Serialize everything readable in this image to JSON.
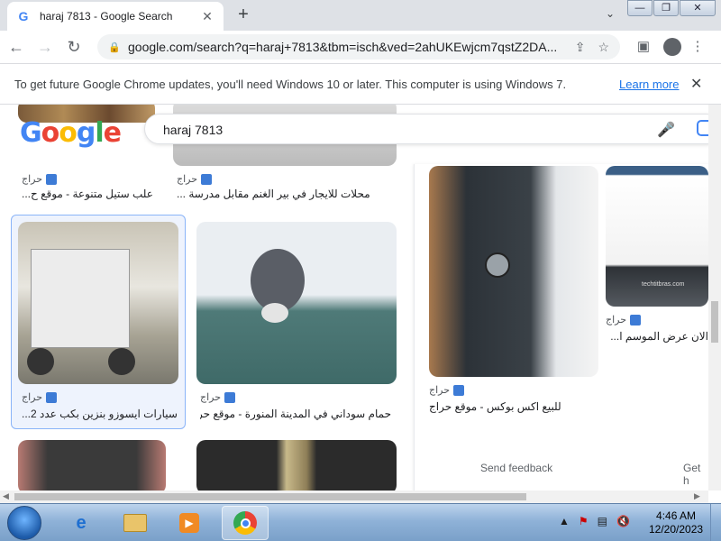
{
  "browser": {
    "tab": {
      "title": "haraj 7813 - Google Search",
      "favicon": "G"
    },
    "new_tab_label": "+",
    "url": "google.com/search?q=haraj+7813&tbm=isch&ved=2ahUKEwjcm7qstZ2DA...",
    "window_buttons": {
      "minimize": "—",
      "restore": "❐",
      "close": "✕"
    }
  },
  "infobar": {
    "message": "To get future Google Chrome updates, you'll need Windows 10 or later. This computer is using Windows 7.",
    "learn_more": "Learn more",
    "close": "✕"
  },
  "search": {
    "query": "haraj 7813",
    "logo": "Google"
  },
  "results": [
    {
      "source": "حراج",
      "caption": "علب ستيل متنوعة - موقع ح..."
    },
    {
      "source": "حراج",
      "caption": "محلات للايجار في بير الغنم مقابل مدرسة ..."
    },
    {
      "source": "حراج",
      "caption": "سيارات ايسوزو بنزين بكب عدد 2..."
    },
    {
      "source": "حراج",
      "caption": "حمام سوداني في المدينة المنورة - موقع حراج"
    }
  ],
  "panel": {
    "main": {
      "source": "حراج",
      "caption": "للبيع اكس بوكس - موقع حراج"
    },
    "side": {
      "source": "حراج",
      "caption": "الان عرض الموسم ا..."
    },
    "side_thumb_text": "techtitbras.com",
    "feedback": "Send feedback",
    "get_help": "Get h"
  },
  "taskbar": {
    "time": "4:46 AM",
    "date": "12/20/2023"
  },
  "colors": {
    "link": "#1a73e8",
    "google_blue": "#4285f4",
    "google_red": "#ea4335",
    "google_yellow": "#fbbc05",
    "google_green": "#34a853"
  }
}
